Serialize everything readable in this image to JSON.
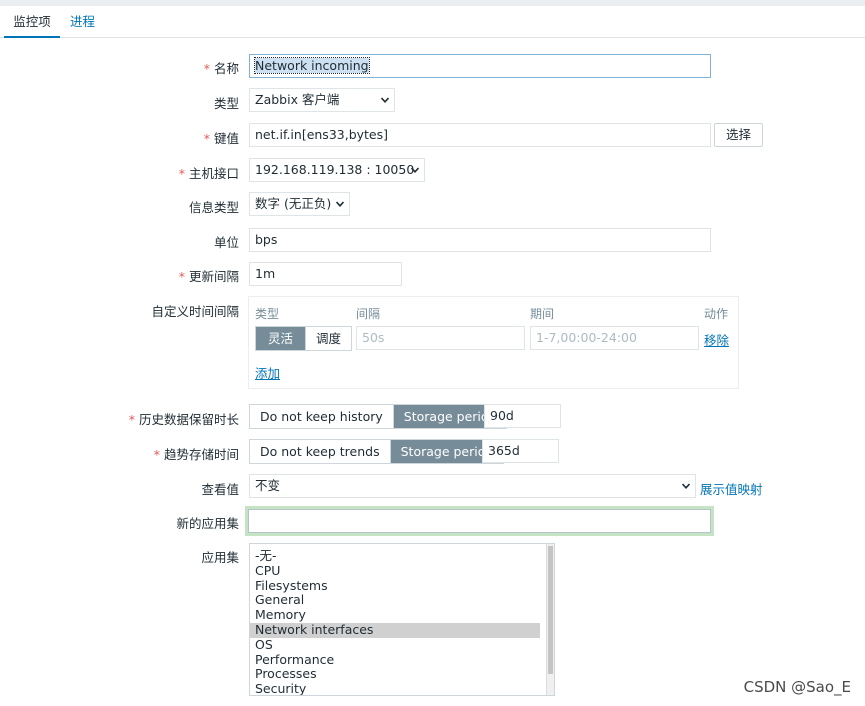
{
  "tabs": [
    {
      "label": "监控项"
    },
    {
      "label": "进程"
    }
  ],
  "form": {
    "name": {
      "label": "名称",
      "value": "Network incoming"
    },
    "type": {
      "label": "类型",
      "value": "Zabbix 客户端"
    },
    "key": {
      "label": "键值",
      "value": "net.if.in[ens33,bytes]",
      "button": "选择"
    },
    "interface": {
      "label": "主机接口",
      "value": "192.168.119.138 : 10050"
    },
    "info_type": {
      "label": "信息类型",
      "value": "数字 (无正负)"
    },
    "units": {
      "label": "单位",
      "value": "bps"
    },
    "update_interval": {
      "label": "更新间隔",
      "value": "1m"
    },
    "custom_intervals": {
      "label": "自定义时间间隔",
      "headers": {
        "type": "类型",
        "interval": "间隔",
        "period": "期间",
        "action": "动作"
      },
      "row": {
        "flexible": "灵活",
        "scheduling": "调度",
        "interval_placeholder": "50s",
        "period_placeholder": "1-7,00:00-24:00",
        "remove": "移除"
      },
      "add": "添加"
    },
    "history": {
      "label": "历史数据保留时长",
      "option_off": "Do not keep history",
      "option_on": "Storage period",
      "value": "90d"
    },
    "trends": {
      "label": "趋势存储时间",
      "option_off": "Do not keep trends",
      "option_on": "Storage period",
      "value": "365d"
    },
    "show_value": {
      "label": "查看值",
      "value": "不变",
      "link": "展示值映射"
    },
    "new_application": {
      "label": "新的应用集",
      "value": ""
    },
    "applications": {
      "label": "应用集",
      "options": [
        "-无-",
        "CPU",
        "Filesystems",
        "General",
        "Memory",
        "Network interfaces",
        "OS",
        "Performance",
        "Processes",
        "Security"
      ],
      "selected": "Network interfaces"
    }
  },
  "watermark": "CSDN @Sao_E",
  "colors": {
    "accent": "#0275b8",
    "required": "#e45959",
    "segment_active": "#768d99"
  }
}
